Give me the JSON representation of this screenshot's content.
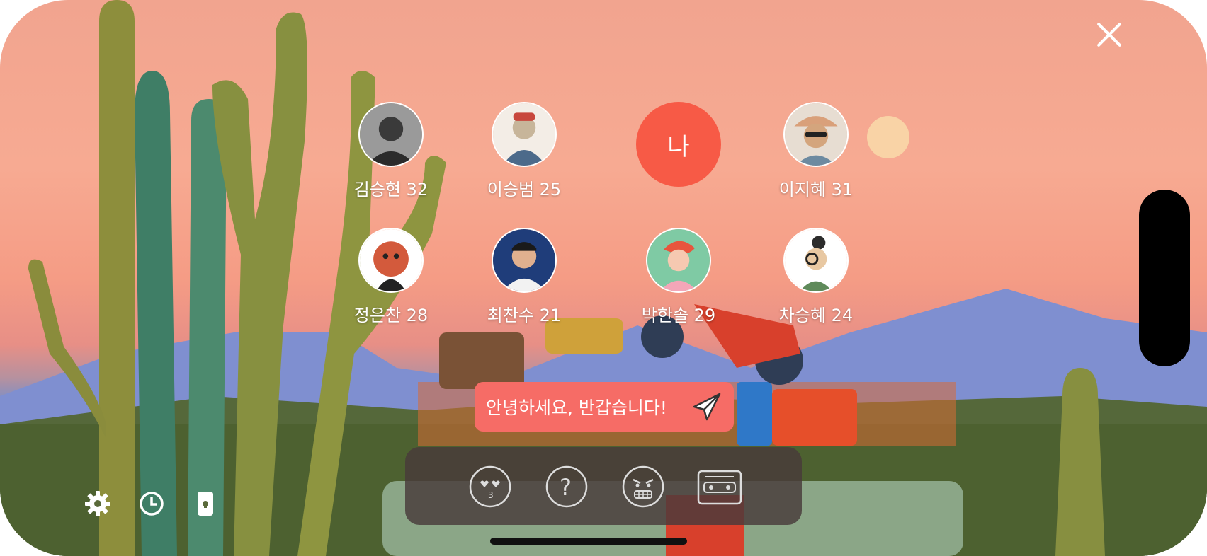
{
  "window": {
    "close_icon": "close-icon"
  },
  "participants_row1": [
    {
      "name": "김승현 32",
      "avatar": "photo"
    },
    {
      "name": "이승범 25",
      "avatar": "illustration"
    },
    {
      "name": "",
      "avatar": "me",
      "me_label": "나"
    },
    {
      "name": "이지혜 31",
      "avatar": "photo"
    }
  ],
  "participants_row2": [
    {
      "name": "정은찬 28",
      "avatar": "illustration"
    },
    {
      "name": "최찬수 21",
      "avatar": "photo"
    },
    {
      "name": "박한솔 29",
      "avatar": "illustration"
    },
    {
      "name": "차승혜 24",
      "avatar": "illustration"
    }
  ],
  "message": {
    "text": "안녕하세요, 반갑습니다!",
    "send_icon": "send-icon"
  },
  "toolbar": {
    "items": [
      {
        "icon": "heart-eyes-kiss-icon"
      },
      {
        "icon": "question-icon"
      },
      {
        "icon": "angry-face-icon"
      },
      {
        "icon": "cassette-icon"
      }
    ]
  },
  "bottom_controls": [
    {
      "icon": "gear-icon"
    },
    {
      "icon": "clock-icon"
    },
    {
      "icon": "phone-lock-icon"
    }
  ],
  "colors": {
    "accent": "#f75a46",
    "message_bubble": "#f66c66",
    "toolbar_bg": "#483a3a"
  }
}
